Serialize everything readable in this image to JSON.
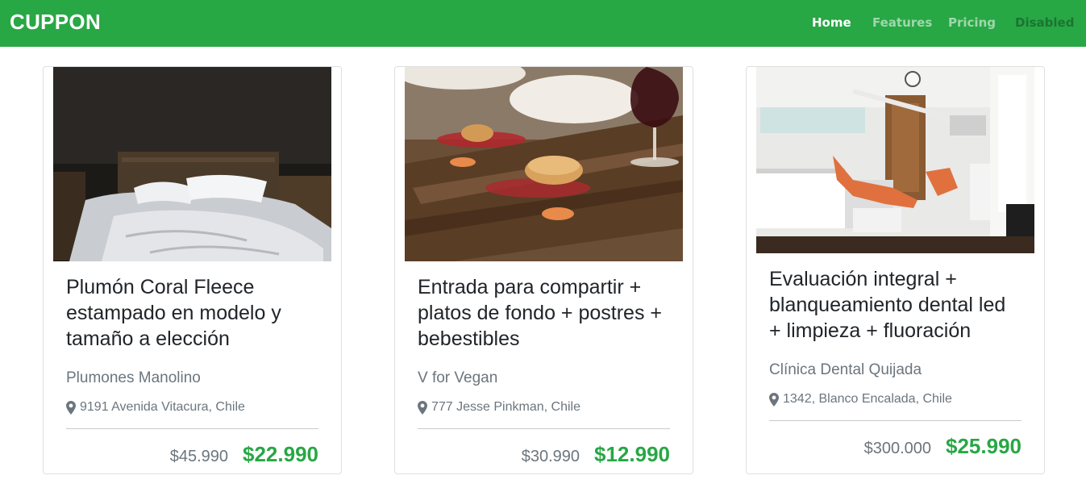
{
  "navbar": {
    "brand": "CUPPON",
    "links": [
      {
        "label": "Home",
        "state": "active"
      },
      {
        "label": "Features",
        "state": "normal"
      },
      {
        "label": "Pricing",
        "state": "normal"
      },
      {
        "label": "Disabled",
        "state": "disabled"
      }
    ]
  },
  "colors": {
    "brand_green": "#28a745",
    "muted_text": "#6c757d"
  },
  "cards": [
    {
      "image": "bedroom-photo",
      "title": "Plumón Coral Fleece estampado en modelo y tamaño a elección",
      "vendor": "Plumones Manolino",
      "address": "9191 Avenida Vitacura, Chile",
      "price_old": "$45.990",
      "price_new": "$22.990"
    },
    {
      "image": "food-photo",
      "title": "Entrada para compartir + platos de fondo + postres + bebestibles",
      "vendor": "V for Vegan",
      "address": "777 Jesse Pinkman, Chile",
      "price_old": "$30.990",
      "price_new": "$12.990"
    },
    {
      "image": "dental-clinic-photo",
      "title": "Evaluación integral + blanqueamiento dental led + limpieza + fluoración",
      "vendor": "Clínica Dental Quijada",
      "address": "1342, Blanco Encalada, Chile",
      "price_old": "$300.000",
      "price_new": "$25.990"
    }
  ]
}
